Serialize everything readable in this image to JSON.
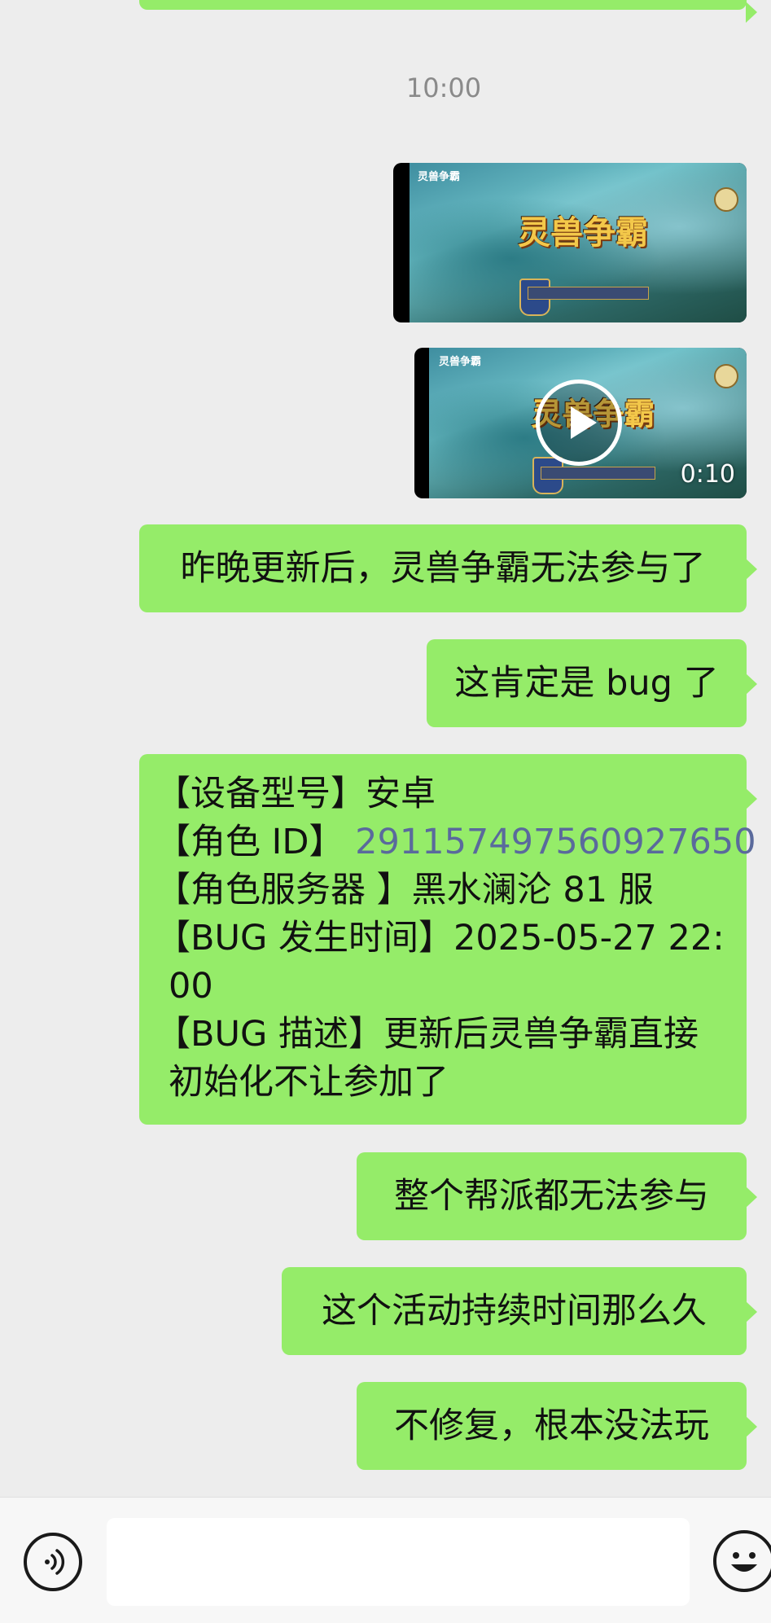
{
  "chat": {
    "timestamp": "10:00",
    "media": [
      {
        "type": "image",
        "caption": "灵兽争霸"
      },
      {
        "type": "video",
        "caption": "灵兽争霸",
        "duration": "0:10"
      }
    ],
    "messages": [
      {
        "text": "昨晚更新后，灵兽争霸无法参与了"
      },
      {
        "text": "这肯定是 bug 了"
      },
      {
        "lines": [
          {
            "label": "【设备型号】",
            "value": "安卓"
          },
          {
            "label": "【角色 ID】 ",
            "value": "2911574975609276​50"
          },
          {
            "label": "【角色服务器 】",
            "value": "黑水澜沦 81 服"
          },
          {
            "label": "【BUG 发生时间】",
            "value": "2025-05-27 22:"
          },
          {
            "label": "",
            "value": "00"
          },
          {
            "label": "【BUG 描述】",
            "value": "更新后灵兽争霸直接"
          },
          {
            "label": "",
            "value": "初始化不让参加了"
          }
        ]
      },
      {
        "text": "整个帮派都无法参与"
      },
      {
        "text": "这个活动持续时间那么久"
      },
      {
        "text": "不修复，根本没法玩"
      }
    ]
  },
  "input_bar": {
    "voice_icon": "voice-icon",
    "input_value": "",
    "emoji_icon": "smiley-icon"
  }
}
